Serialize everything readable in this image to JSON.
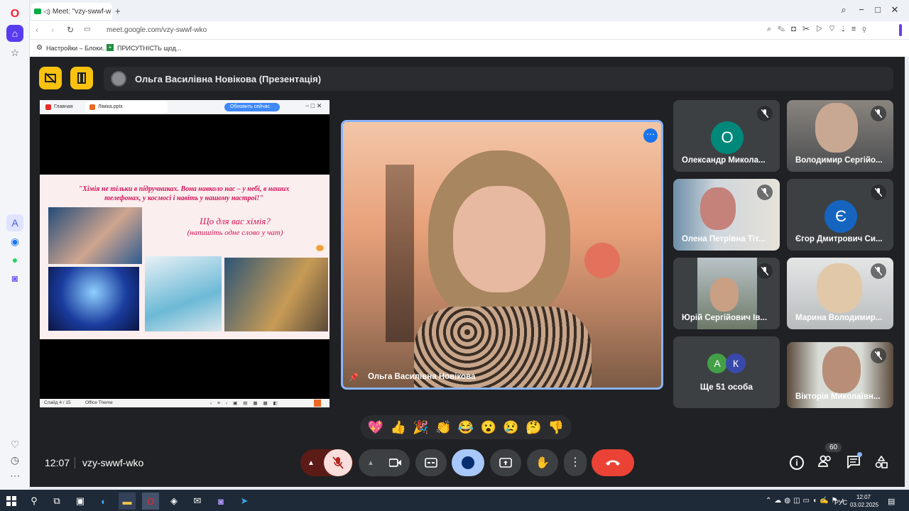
{
  "browser": {
    "tab_title": "Meet: \"vzy-swwf-w",
    "url": "meet.google.com/vzy-swwf-wko",
    "bookmarks": [
      "Настройки – Блоки...",
      "ПРИСУТНІСТЬ щод..."
    ]
  },
  "meet": {
    "presenter_title": "Ольга Василівна Новікова (Презентація)",
    "time": "12:07",
    "meeting_code": "vzy-swwf-wko",
    "participant_count": "60",
    "main_speaker": "Ольга Василівна Новікова",
    "slide": {
      "browser_tab1": "Главная",
      "browser_tab2": "Ліміка.pptx",
      "update_btn": "Обновить сейчас",
      "quote": "\"Хімія не тільки в підручниках. Вона навколо нас – у небі, в наших телефонах, у космосі і навіть у нашому настрої!\"",
      "question": "Що для вас хімія?",
      "prompt": "(напишіть одне слово у чат)",
      "status": "Слайд 4 / 15",
      "theme": "Office Theme"
    },
    "participants": [
      {
        "name": "Олександр Микола...",
        "initial": "О",
        "color": "#00897b"
      },
      {
        "name": "Володимир Сергійо..."
      },
      {
        "name": "Олена Петрівна Тіт..."
      },
      {
        "name": "Єгор Дмитрович Си...",
        "initial": "Є",
        "color": "#1565c0"
      },
      {
        "name": "Юрій Сергійович Ів..."
      },
      {
        "name": "Марина Володимир..."
      },
      {
        "name": "Ще 51 особа",
        "initials": [
          "А",
          "К"
        ]
      },
      {
        "name": "Вікторія Миколаївн..."
      }
    ],
    "reactions": [
      "💖",
      "👍",
      "🎉",
      "👏",
      "😂",
      "😮",
      "😢",
      "🤔",
      "👎"
    ]
  },
  "taskbar": {
    "lang": "РУС",
    "clock_time": "12:07",
    "clock_date": "03.02.2025"
  },
  "colors": {
    "meet_bg": "#202124",
    "accent_yellow": "#f9c20f",
    "hangup_red": "#ea4335",
    "active_blue": "#8ab4f8"
  }
}
